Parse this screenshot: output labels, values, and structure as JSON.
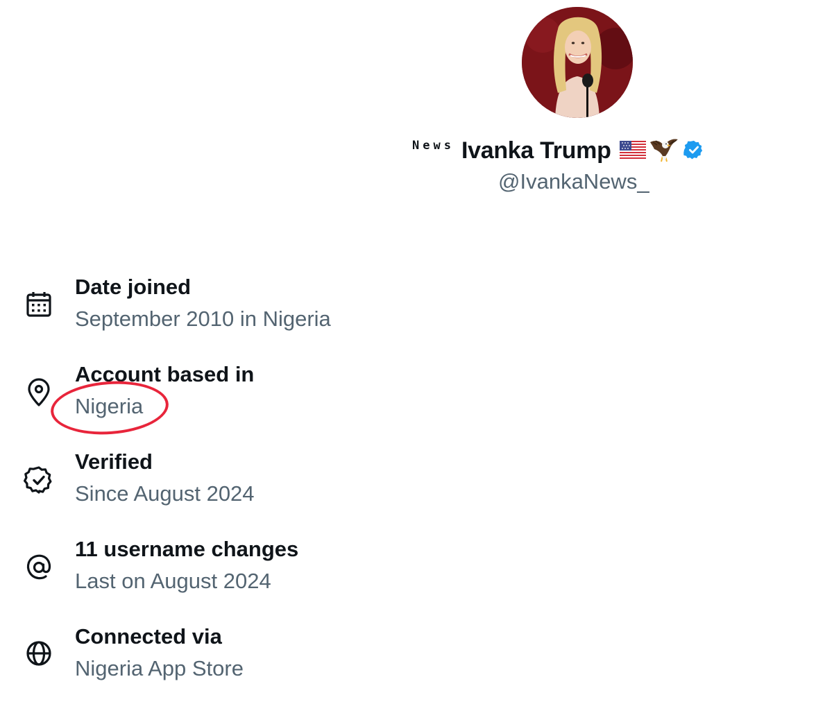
{
  "profile": {
    "name_prefix": "News",
    "display_name": "Ivanka Trump",
    "handle": "@IvankaNews_",
    "avatar_icon": "profile-photo",
    "flag_icon": "us-flag-icon",
    "eagle_icon": "eagle-icon",
    "verified_icon": "verified-badge-icon"
  },
  "about": {
    "items": [
      {
        "icon": "calendar-icon",
        "label": "Date joined",
        "value": "September 2010 in Nigeria"
      },
      {
        "icon": "location-pin-icon",
        "label": "Account based in",
        "value": "Nigeria"
      },
      {
        "icon": "verified-outline-icon",
        "label": "Verified",
        "value": "Since August 2024"
      },
      {
        "icon": "at-sign-icon",
        "label": "11 username changes",
        "value": "Last on August 2024"
      },
      {
        "icon": "globe-icon",
        "label": "Connected via",
        "value": "Nigeria App Store"
      }
    ]
  },
  "colors": {
    "text_primary": "#0f1419",
    "text_secondary": "#536471",
    "verified_blue": "#1d9bf0",
    "highlight_red": "#e8253b"
  }
}
